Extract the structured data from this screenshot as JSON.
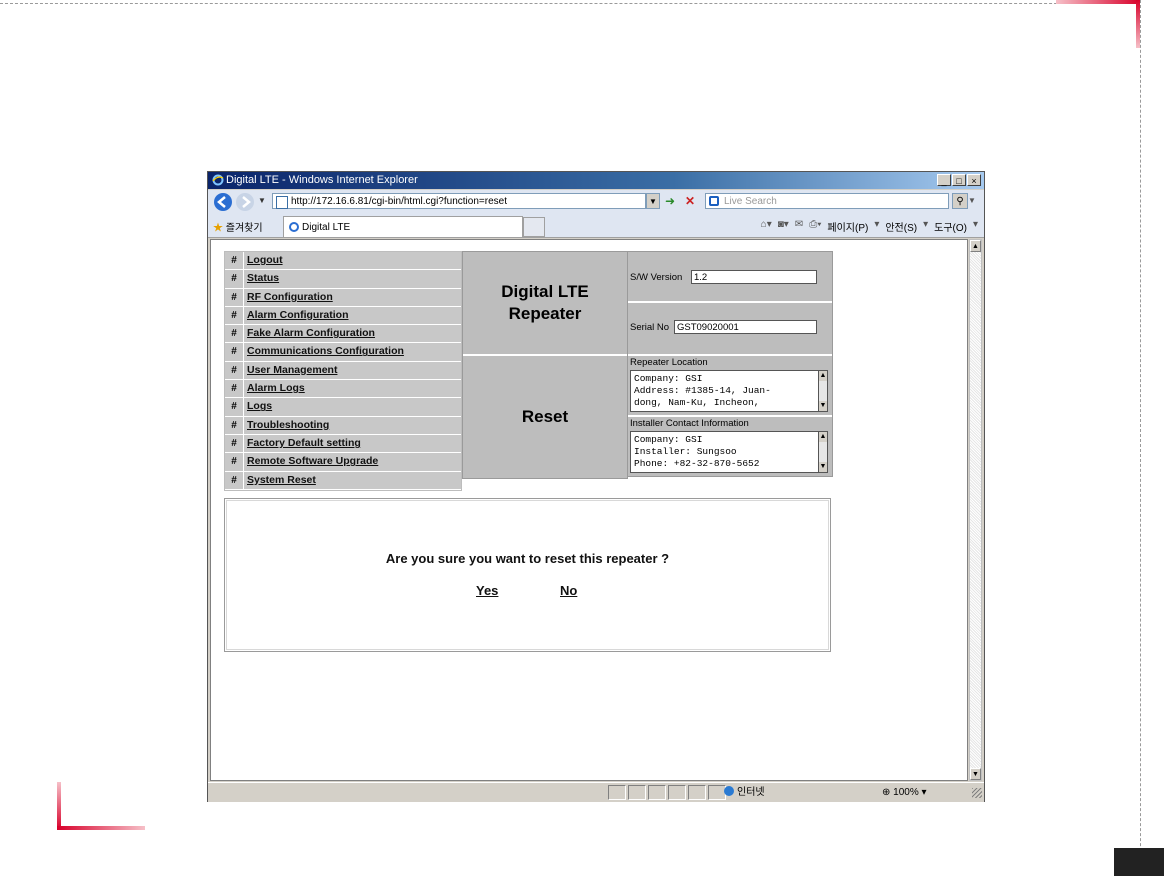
{
  "browser": {
    "title": "Digital LTE - Windows Internet Explorer",
    "url": "http://172.16.6.81/cgi-bin/html.cgi?function=reset",
    "search_placeholder": "Live Search",
    "favorites_label": "즐겨찾기",
    "tab_label": "Digital LTE",
    "cmd_page": "페이지(P)",
    "cmd_safety": "안전(S)",
    "cmd_tools": "도구(O)",
    "status_zone": "인터넷",
    "zoom": "100%",
    "controls": {
      "minimize": "_",
      "maximize": "□",
      "close": "×"
    }
  },
  "menu": {
    "items": [
      {
        "label": "Logout"
      },
      {
        "label": "Status"
      },
      {
        "label": "RF Configuration"
      },
      {
        "label": "Alarm Configuration"
      },
      {
        "label": "Fake Alarm Configuration"
      },
      {
        "label": "Communications Configuration"
      },
      {
        "label": "User Management"
      },
      {
        "label": "Alarm Logs"
      },
      {
        "label": "Logs"
      },
      {
        "label": "Troubleshooting"
      },
      {
        "label": "Factory Default setting"
      },
      {
        "label": "Remote Software Upgrade"
      },
      {
        "label": "System Reset"
      }
    ],
    "bullet": "#"
  },
  "header": {
    "title_line1": "Digital LTE",
    "title_line2": "Repeater",
    "section": "Reset"
  },
  "info": {
    "sw_version_label": "S/W Version",
    "sw_version": "1.2",
    "serial_label": "Serial No",
    "serial": "GST09020001",
    "location_label": "Repeater Location",
    "location": "Company: GSI\nAddress: #1385-14, Juan-\ndong, Nam-Ku, Incheon,",
    "installer_label": "Installer Contact Information",
    "installer": "Company: GSI\nInstaller: Sungsoo\nPhone: +82-32-870-5652"
  },
  "confirm": {
    "question": "Are you sure you want to reset this repeater ?",
    "yes": "Yes",
    "no": "No"
  },
  "colors": {
    "accent_red": "#d8002a",
    "panel_gray": "#bdbdbd",
    "ie_blue": "#0a246a"
  }
}
